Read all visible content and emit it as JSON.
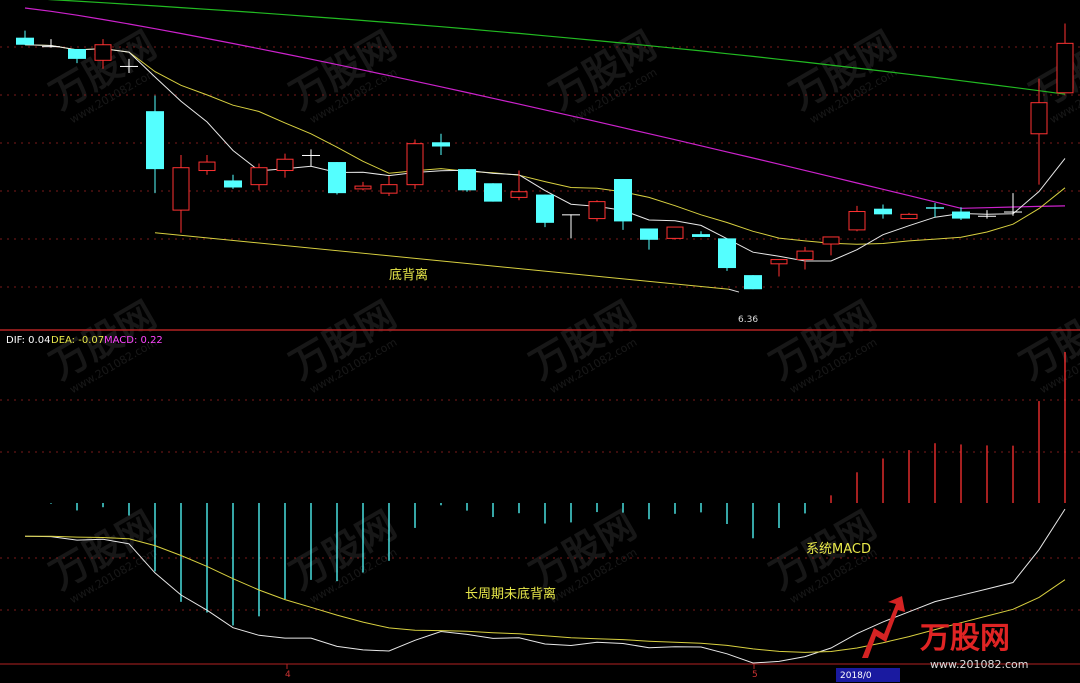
{
  "chart_data": [
    {
      "type": "candlestick",
      "panel": "price",
      "annotations": {
        "divergence_label": "底背离",
        "low_price": "6.36"
      },
      "candles": [
        {
          "o": 8.34,
          "h": 8.39,
          "l": 8.29,
          "c": 8.29
        },
        {
          "o": 8.28,
          "h": 8.33,
          "l": 8.27,
          "c": 8.28
        },
        {
          "o": 8.26,
          "h": 8.26,
          "l": 8.16,
          "c": 8.19
        },
        {
          "o": 8.18,
          "h": 8.33,
          "l": 8.12,
          "c": 8.29
        },
        {
          "o": 8.14,
          "h": 8.19,
          "l": 8.09,
          "c": 8.14
        },
        {
          "o": 7.82,
          "h": 7.93,
          "l": 7.24,
          "c": 7.41
        },
        {
          "o": 7.12,
          "h": 7.51,
          "l": 6.96,
          "c": 7.42
        },
        {
          "o": 7.4,
          "h": 7.51,
          "l": 7.37,
          "c": 7.46
        },
        {
          "o": 7.33,
          "h": 7.37,
          "l": 7.27,
          "c": 7.28
        },
        {
          "o": 7.3,
          "h": 7.45,
          "l": 7.26,
          "c": 7.42
        },
        {
          "o": 7.4,
          "h": 7.52,
          "l": 7.35,
          "c": 7.48
        },
        {
          "o": 7.51,
          "h": 7.55,
          "l": 7.43,
          "c": 7.51
        },
        {
          "o": 7.46,
          "h": 7.46,
          "l": 7.23,
          "c": 7.24
        },
        {
          "o": 7.27,
          "h": 7.32,
          "l": 7.26,
          "c": 7.29
        },
        {
          "o": 7.24,
          "h": 7.36,
          "l": 7.22,
          "c": 7.3
        },
        {
          "o": 7.3,
          "h": 7.62,
          "l": 7.27,
          "c": 7.59
        },
        {
          "o": 7.6,
          "h": 7.66,
          "l": 7.51,
          "c": 7.57
        },
        {
          "o": 7.41,
          "h": 7.41,
          "l": 7.25,
          "c": 7.26
        },
        {
          "o": 7.31,
          "h": 7.31,
          "l": 7.18,
          "c": 7.18
        },
        {
          "o": 7.21,
          "h": 7.4,
          "l": 7.19,
          "c": 7.25
        },
        {
          "o": 7.23,
          "h": 7.23,
          "l": 7.0,
          "c": 7.03
        },
        {
          "o": 7.09,
          "h": 7.09,
          "l": 6.92,
          "c": 7.09
        },
        {
          "o": 7.06,
          "h": 7.19,
          "l": 7.04,
          "c": 7.18
        },
        {
          "o": 7.34,
          "h": 7.34,
          "l": 6.98,
          "c": 7.04
        },
        {
          "o": 6.99,
          "h": 6.99,
          "l": 6.84,
          "c": 6.91
        },
        {
          "o": 6.92,
          "h": 7.0,
          "l": 6.91,
          "c": 7.0
        },
        {
          "o": 6.95,
          "h": 6.97,
          "l": 6.93,
          "c": 6.93
        },
        {
          "o": 6.92,
          "h": 6.92,
          "l": 6.69,
          "c": 6.71
        },
        {
          "o": 6.66,
          "h": 6.66,
          "l": 6.56,
          "c": 6.56
        },
        {
          "o": 6.74,
          "h": 6.77,
          "l": 6.65,
          "c": 6.77
        },
        {
          "o": 6.77,
          "h": 6.86,
          "l": 6.7,
          "c": 6.83
        },
        {
          "o": 6.88,
          "h": 6.93,
          "l": 6.8,
          "c": 6.93
        },
        {
          "o": 6.98,
          "h": 7.15,
          "l": 6.97,
          "c": 7.11
        },
        {
          "o": 7.13,
          "h": 7.16,
          "l": 7.06,
          "c": 7.09
        },
        {
          "o": 7.06,
          "h": 7.1,
          "l": 7.06,
          "c": 7.09
        },
        {
          "o": 7.14,
          "h": 7.17,
          "l": 7.07,
          "c": 7.13
        },
        {
          "o": 7.11,
          "h": 7.14,
          "l": 7.05,
          "c": 7.06
        },
        {
          "o": 7.08,
          "h": 7.12,
          "l": 7.06,
          "c": 7.08
        },
        {
          "o": 7.11,
          "h": 7.24,
          "l": 7.08,
          "c": 7.11
        },
        {
          "o": 7.66,
          "h": 8.05,
          "l": 7.3,
          "c": 7.88
        },
        {
          "o": 7.95,
          "h": 8.44,
          "l": 7.95,
          "c": 8.3
        }
      ],
      "ylim": [
        6.3,
        8.55
      ]
    },
    {
      "type": "macd",
      "panel": "indicator",
      "title": "DIF: 0.04  DEA: -0.07  MACD: 0.22",
      "legend": {
        "dif_label": "DIF: 0.04",
        "dea_label": "DEA: -0.07",
        "macd_label": "MACD: 0.22"
      },
      "annotations": {
        "divergence_label": "长周期未底背离",
        "system_label": "系统MACD"
      },
      "x_tick_labels": [
        "4",
        "5"
      ],
      "date_label": "2018/0",
      "ylim": [
        -0.29,
        0.32
      ]
    }
  ],
  "watermark": {
    "brand": "万股网",
    "url": "www.201082.com"
  }
}
